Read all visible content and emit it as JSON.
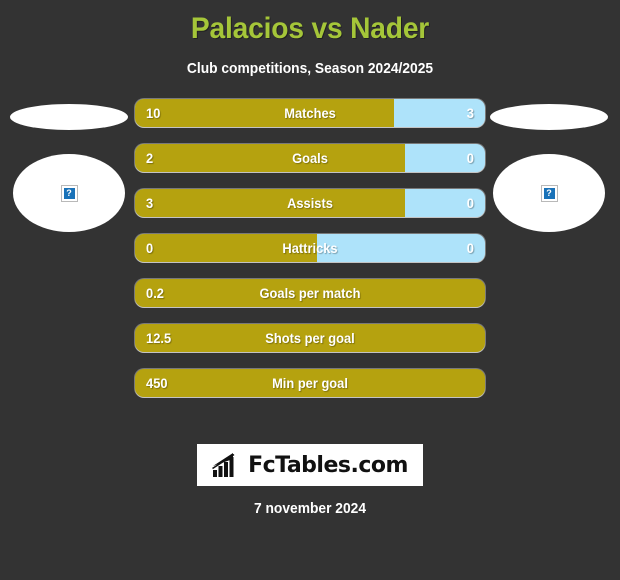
{
  "header": {
    "title": "Palacios vs Nader",
    "subtitle": "Club competitions, Season 2024/2025",
    "title_color": "#a5c639",
    "subtitle_color": "#ffffff"
  },
  "colors": {
    "background": "#333333",
    "bar_primary": "#b5a20f",
    "bar_secondary": "#aee3fa",
    "logo_background": "#ffffff"
  },
  "left_player": {
    "name": "",
    "logo_placeholder": "broken-image"
  },
  "right_player": {
    "name": "",
    "logo_placeholder": "broken-image"
  },
  "chart_data": {
    "type": "bar",
    "title": "Palacios vs Nader",
    "subtitle": "Club competitions, Season 2024/2025",
    "categories": [
      "Matches",
      "Goals",
      "Assists",
      "Hattricks",
      "Goals per match",
      "Shots per goal",
      "Min per goal"
    ],
    "series": [
      {
        "name": "Palacios",
        "values": [
          "10",
          "2",
          "3",
          "0",
          "0.2",
          "12.5",
          "450"
        ]
      },
      {
        "name": "Nader",
        "values": [
          "3",
          "0",
          "0",
          "0",
          null,
          null,
          null
        ]
      }
    ],
    "fill_percent": [
      74,
      77,
      77,
      52,
      100,
      100,
      100
    ],
    "legend": "none",
    "grid": false
  },
  "rows": [
    {
      "label": "Matches",
      "left": "10",
      "right": "3",
      "fill": 74,
      "split": true
    },
    {
      "label": "Goals",
      "left": "2",
      "right": "0",
      "fill": 77,
      "split": true
    },
    {
      "label": "Assists",
      "left": "3",
      "right": "0",
      "fill": 77,
      "split": true
    },
    {
      "label": "Hattricks",
      "left": "0",
      "right": "0",
      "fill": 52,
      "split": true
    },
    {
      "label": "Goals per match",
      "left": "0.2",
      "right": "",
      "fill": 100,
      "split": false
    },
    {
      "label": "Shots per goal",
      "left": "12.5",
      "right": "",
      "fill": 100,
      "split": false
    },
    {
      "label": "Min per goal",
      "left": "450",
      "right": "",
      "fill": 100,
      "split": false
    }
  ],
  "footer": {
    "logo_text": "FcTables.com",
    "logo_icon": "bar-chart-trend-icon",
    "date": "7 november 2024"
  }
}
